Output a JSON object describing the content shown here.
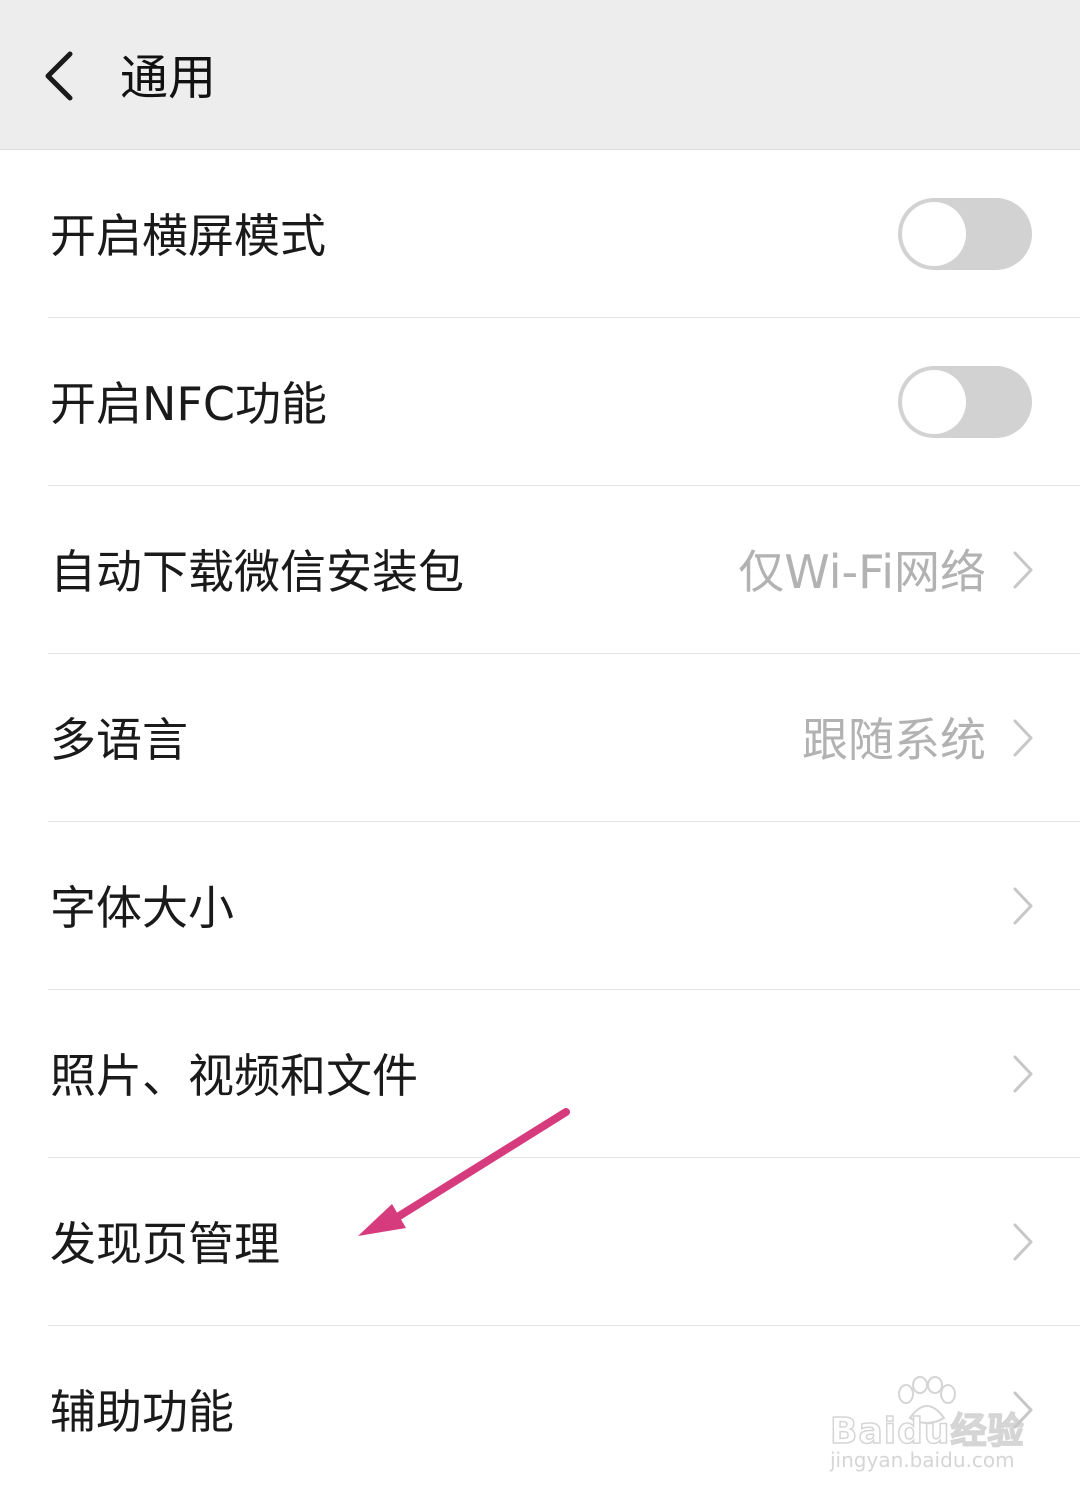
{
  "header": {
    "title": "通用",
    "back_icon": "chevron-left-icon"
  },
  "settings": {
    "items": [
      {
        "label": "开启横屏模式",
        "control": "toggle",
        "on": false
      },
      {
        "label": "开启NFC功能",
        "control": "toggle",
        "on": false
      },
      {
        "label": "自动下载微信安装包",
        "value": "仅Wi-Fi网络",
        "control": "chevron"
      },
      {
        "label": "多语言",
        "value": "跟随系统",
        "control": "chevron"
      },
      {
        "label": "字体大小",
        "control": "chevron"
      },
      {
        "label": "照片、视频和文件",
        "control": "chevron"
      },
      {
        "label": "发现页管理",
        "control": "chevron"
      },
      {
        "label": "辅助功能",
        "control": "chevron"
      }
    ]
  },
  "annotation": {
    "arrow_color": "#d63b7d",
    "target": "发现页管理"
  },
  "watermark": {
    "brand": "Baidu经验",
    "url": "jingyan.baidu.com"
  },
  "colors": {
    "header_bg": "#ededed",
    "toggle_off": "#d2d2d2",
    "secondary_text": "#b2b2b2"
  }
}
